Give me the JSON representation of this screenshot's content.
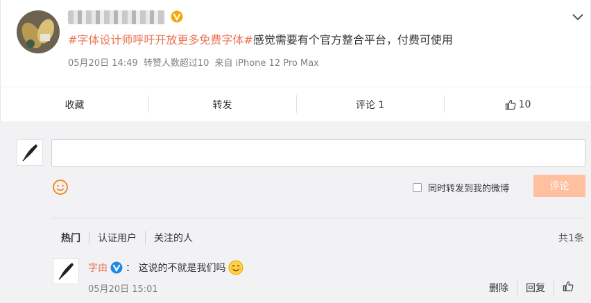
{
  "post": {
    "hashtag": "#字体设计师呼吁开放更多免费字体#",
    "text": "感觉需要有个官方整合平台，付费可使用",
    "date": "05月20日 14:49",
    "repost_note": "转赞人数超过10",
    "source_prefix": "来自",
    "source": "iPhone 12 Pro Max"
  },
  "actions": {
    "favorite": "收藏",
    "repost": "转发",
    "comment": "评论 1",
    "like_count": "10"
  },
  "composer": {
    "forward_label": "同时转发到我的微博",
    "submit_label": "评论"
  },
  "filters": [
    "热门",
    "认证用户",
    "关注的人"
  ],
  "total": "共1条",
  "comment": {
    "author": "字由",
    "text": "：  这说的不就是我们吗",
    "time": "05月20日 15:01",
    "delete_label": "删除",
    "reply_label": "回复"
  },
  "colors": {
    "accent": "#eb7350",
    "submit_disabled": "#ffc09f",
    "verified_orange": "#f7a70a",
    "verified_blue": "#1a8ae5"
  }
}
